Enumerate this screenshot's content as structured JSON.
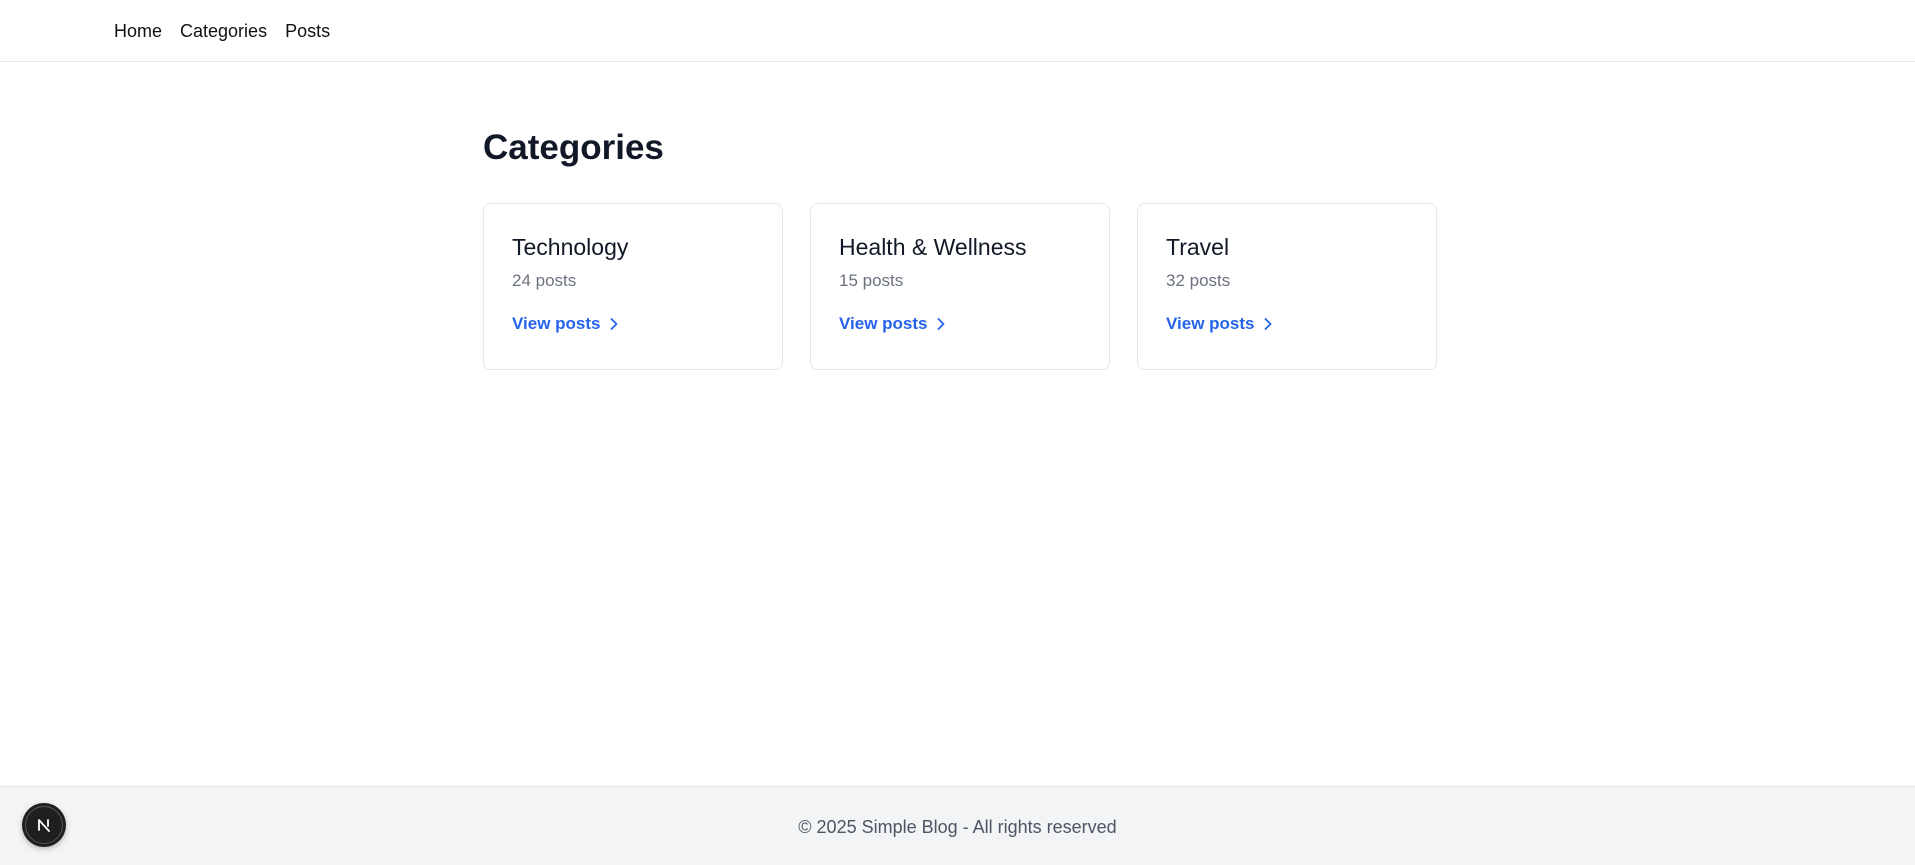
{
  "nav": {
    "items": [
      {
        "label": "Home"
      },
      {
        "label": "Categories"
      },
      {
        "label": "Posts"
      }
    ]
  },
  "main": {
    "title": "Categories",
    "cards": [
      {
        "title": "Technology",
        "count": "24 posts",
        "link_label": "View posts"
      },
      {
        "title": "Health & Wellness",
        "count": "15 posts",
        "link_label": "View posts"
      },
      {
        "title": "Travel",
        "count": "32 posts",
        "link_label": "View posts"
      }
    ]
  },
  "footer": {
    "text": "© 2025 Simple Blog - All rights reserved"
  },
  "icons": {
    "card_link": "chevron-right-icon",
    "badge": "nextjs-logo-icon"
  },
  "colors": {
    "link": "#2563eb",
    "muted": "#6b7280",
    "footer_bg": "#f3f4f6"
  }
}
